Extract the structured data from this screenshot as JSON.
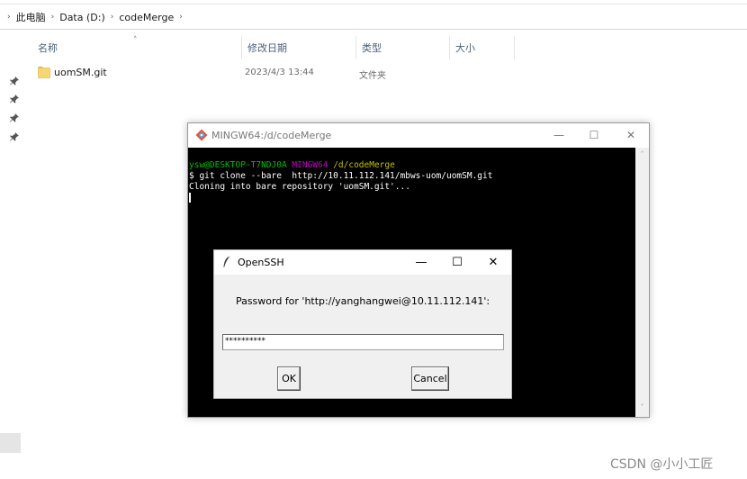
{
  "explorer": {
    "breadcrumb": [
      "此电脑",
      "Data (D:)",
      "codeMerge"
    ],
    "columns": {
      "name": "名称",
      "modified": "修改日期",
      "type": "类型",
      "size": "大小"
    },
    "files": [
      {
        "name": "uomSM.git",
        "modified": "2023/4/3 13:44",
        "type": "文件夹",
        "size": ""
      }
    ],
    "colors": {
      "header_text": "#4c607a",
      "folder": "#f7d675"
    }
  },
  "terminal": {
    "title": "MINGW64:/d/codeMerge",
    "prompt_user": "ysw@DESKTOP-T7NDJ0A",
    "prompt_env": "MINGW64",
    "prompt_path": "/d/codeMerge",
    "command": "$ git clone --bare  http://10.11.112.141/mbws-uom/uomSM.git",
    "output": "Cloning into bare repository 'uomSM.git'...",
    "controls": {
      "minimize": "—",
      "maximize": "☐",
      "close": "✕"
    },
    "colors": {
      "user": "#00c000",
      "env": "#c000c0",
      "path": "#c0c000",
      "background": "#000000"
    }
  },
  "ssh_dialog": {
    "title": "OpenSSH",
    "prompt": "Password for 'http://yanghangwei@10.11.112.141':",
    "password_value": "**********",
    "ok_label": "OK",
    "cancel_label": "Cancel",
    "controls": {
      "minimize": "—",
      "maximize": "☐",
      "close": "✕"
    }
  },
  "watermark": "CSDN @小小工匠"
}
